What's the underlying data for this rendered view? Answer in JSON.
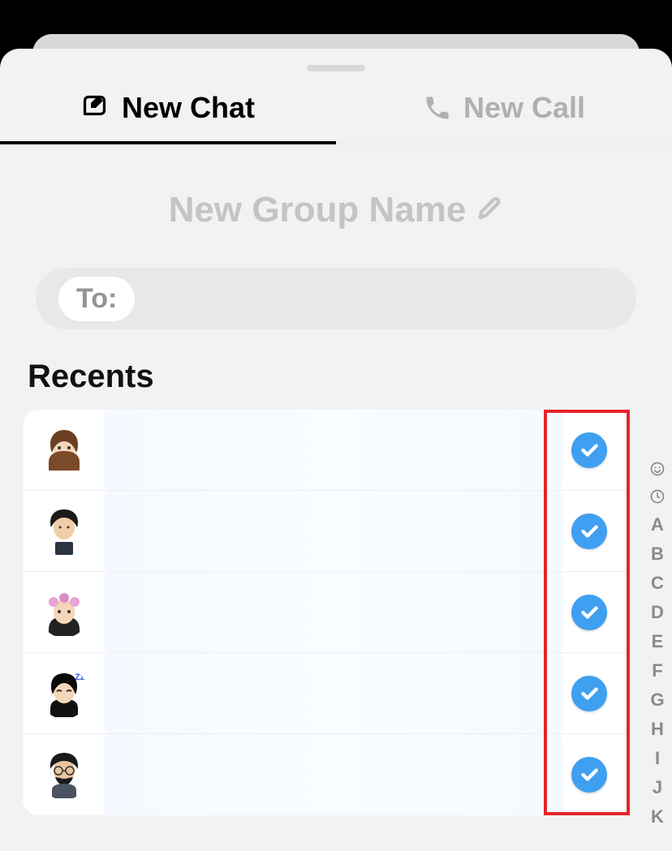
{
  "tabs": {
    "chat": "New Chat",
    "call": "New Call"
  },
  "group_name_placeholder": "New Group Name",
  "to_label": "To:",
  "section_title": "Recents",
  "contacts": [
    {
      "avatar": "brown-hair-female",
      "selected": true
    },
    {
      "avatar": "dark-hair-male-phone",
      "selected": true
    },
    {
      "avatar": "flower-crown-female",
      "selected": true
    },
    {
      "avatar": "sleeping-female",
      "selected": true
    },
    {
      "avatar": "beard-glasses-male",
      "selected": true
    }
  ],
  "alpha_index": [
    "A",
    "B",
    "C",
    "D",
    "E",
    "F",
    "G",
    "H",
    "I",
    "J",
    "K"
  ],
  "colors": {
    "accent_blue": "#3f9ff0",
    "highlight_red": "#e4252b",
    "inactive_gray": "#b0b0b0"
  }
}
